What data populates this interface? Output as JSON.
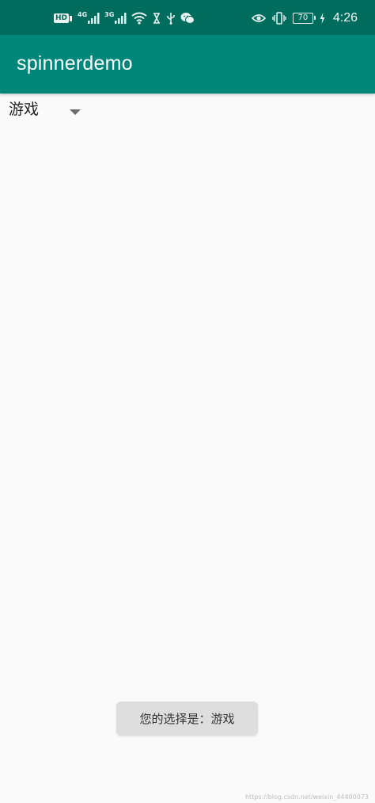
{
  "status_bar": {
    "left_icons": [
      "hd-icon",
      "4g-signal-icon",
      "3g-signal-icon",
      "wifi-icon",
      "hourglass-icon",
      "usb-icon",
      "wechat-icon"
    ],
    "hd_label": "HD",
    "net_label_1": "4G",
    "net_label_2": "3G",
    "right_icons": [
      "eye-icon",
      "vibrate-icon",
      "battery-icon",
      "charging-icon"
    ],
    "battery_level": "70",
    "time": "4:26"
  },
  "app_bar": {
    "title": "spinnerdemo"
  },
  "spinner": {
    "selected_value": "游戏",
    "arrow_icon": "dropdown-arrow-icon"
  },
  "toast": {
    "message": "您的选择是：游戏"
  },
  "watermark": {
    "text": "https://blog.csdn.net/weixin_44400073"
  },
  "colors": {
    "status_bar": "#006c5e",
    "app_bar": "#00877a",
    "background": "#fafafa",
    "toast_bg": "#dedede"
  }
}
